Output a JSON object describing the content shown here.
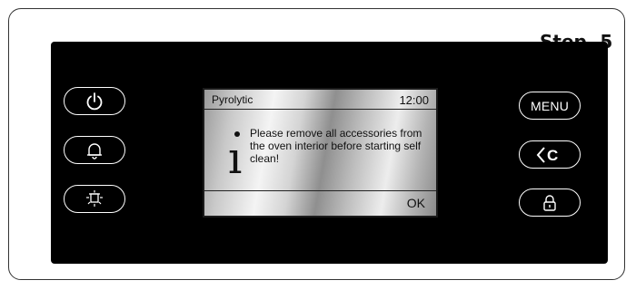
{
  "step_label": "Step. 5",
  "screen": {
    "title": "Pyrolytic",
    "time": "12:00",
    "message": "Please remove all accessories from the oven interior before starting self clean!",
    "ok_label": "OK"
  },
  "left_buttons": [
    {
      "icon": "power-icon"
    },
    {
      "icon": "bell-icon"
    },
    {
      "icon": "oven-light-icon"
    }
  ],
  "right_buttons": [
    {
      "label": "MENU"
    },
    {
      "label": "<C",
      "icon": "back-cancel-icon"
    },
    {
      "icon": "lock-icon"
    }
  ],
  "colors": {
    "panel": "#000000",
    "button_outline": "#ffffff",
    "frame_border": "#333333"
  }
}
